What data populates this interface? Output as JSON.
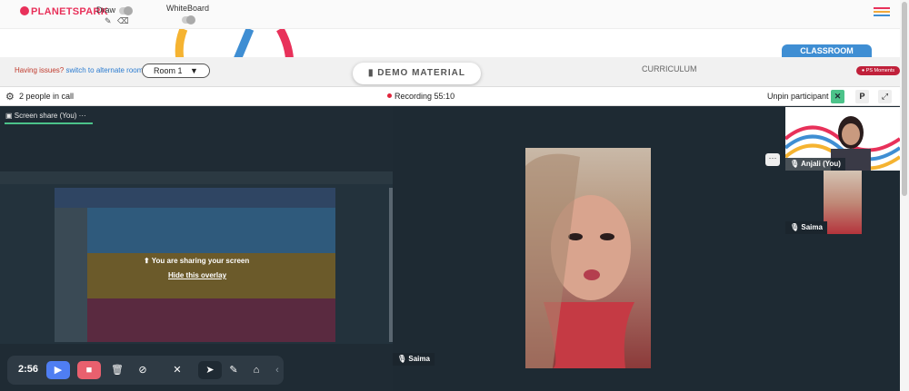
{
  "topbar": {
    "logo_text": "PLANETSPARK",
    "draw_label": "Draw",
    "whiteboard_label": "WhiteBoard"
  },
  "subbar": {
    "issues_text": "Having issues?",
    "alternate_link": "switch to alternate room",
    "room_value": "Room 1",
    "demo_label": "DEMO MATERIAL",
    "curriculum_label": "CURRICULUM",
    "classroom_label": "CLASSROOM",
    "ps_moments_label": "PS Moments"
  },
  "callbar": {
    "people_count": "2 people in call",
    "recording_label": "Recording",
    "recording_time": "55:10",
    "unpin_label": "Unpin participant",
    "p_label": "P"
  },
  "screenshare": {
    "tab_label": "Screen share (You)",
    "tab_more": "···",
    "overlay_message": "You are sharing your screen",
    "overlay_link": "Hide this overlay"
  },
  "main_video": {
    "participant_name": "Saima"
  },
  "side_panel": {
    "thumb1_name": "Anjali (You)",
    "thumb2_name": "Saima"
  },
  "toolbar": {
    "timer": "2:56"
  },
  "colors": {
    "accent_green": "#4cc38a",
    "record_red": "#e0243c",
    "classroom_blue": "#3f8ed3",
    "brand_red": "#e8315a"
  }
}
